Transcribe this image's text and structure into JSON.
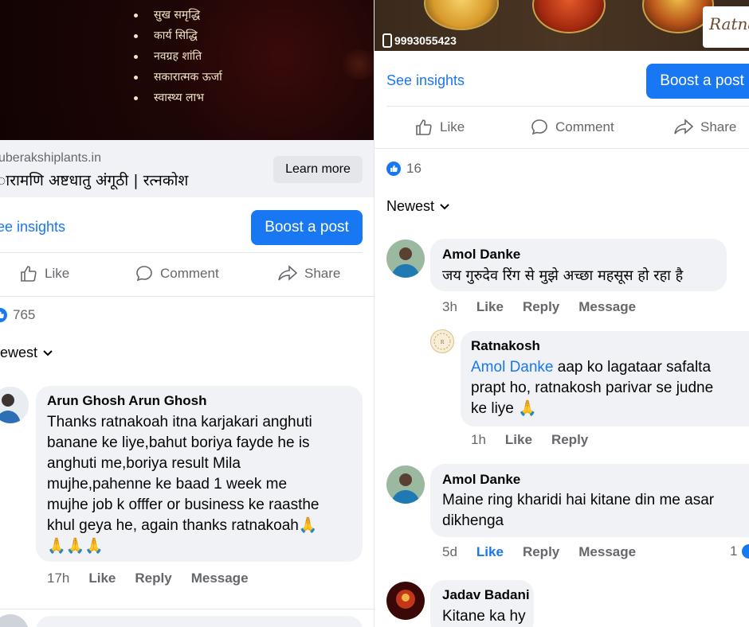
{
  "left_post": {
    "ad_bullets": [
      "सुख समृद्धि",
      "कार्य सिद्धि",
      "नवग्रह शांति",
      "सकारात्मक ऊर्जा",
      "स्वास्थ्य लाभ"
    ],
    "link_domain": "uberakshiplants.in",
    "link_headline": "ारामणि अष्टधातु अंगूठी | रत्नकोश",
    "learn_more": "Learn more",
    "see_insights": "ee insights",
    "boost": "Boost a post",
    "actions": {
      "like": "Like",
      "comment": "Comment",
      "share": "Share"
    },
    "reaction_count": "765",
    "sort": "lewest",
    "comments": [
      {
        "author": "Arun Ghosh Arun Ghosh",
        "lines": [
          "Thanks ratnakoah itna karjakari anghuti",
          "banane ke liye,bahut boriya fayde he is",
          "anghuti me,boriya result Mila",
          "mujhe,pahenne ke baad 1 week me",
          "mujhe job k offfer or business ke raasthe",
          "khul geya he, again thanks ratnakoah🙏",
          "🙏🙏🙏"
        ],
        "time": "17h",
        "like": "Like",
        "reply": "Reply",
        "message": "Message"
      }
    ]
  },
  "right_post": {
    "phone": "9993055423",
    "logo_text": "Ratnak",
    "see_insights": "See insights",
    "boost": "Boost a post",
    "actions": {
      "like": "Like",
      "comment": "Comment",
      "share": "Share"
    },
    "reaction_count": "16",
    "sort": "Newest",
    "comments": [
      {
        "author": "Amol Danke",
        "text": "जय गुरुदेव रिंग से मुझे अच्छा महसूस हो रहा है",
        "time": "3h",
        "like": "Like",
        "reply": "Reply",
        "message": "Message"
      },
      {
        "author": "Ratnakosh",
        "tag": "Amol Danke",
        "text_first": " aap ko lagataar safalta",
        "lines": [
          "prapt ho, ratnakosh parivar se judne",
          "ke liye 🙏"
        ],
        "time": "1h",
        "like": "Like",
        "reply": "Reply"
      },
      {
        "author": "Amol Danke",
        "lines": [
          "Maine ring kharidi hai kitane din me asar",
          "dikhenga"
        ],
        "time": "5d",
        "like": "Like",
        "reply": "Reply",
        "message": "Message",
        "reaction_count": "1"
      },
      {
        "author": "Jadav Badani",
        "text": "Kitane ka hy"
      }
    ]
  },
  "colors": {
    "accent": "#1877f2",
    "bubble": "#f0f2f5",
    "muted": "#65676b"
  }
}
